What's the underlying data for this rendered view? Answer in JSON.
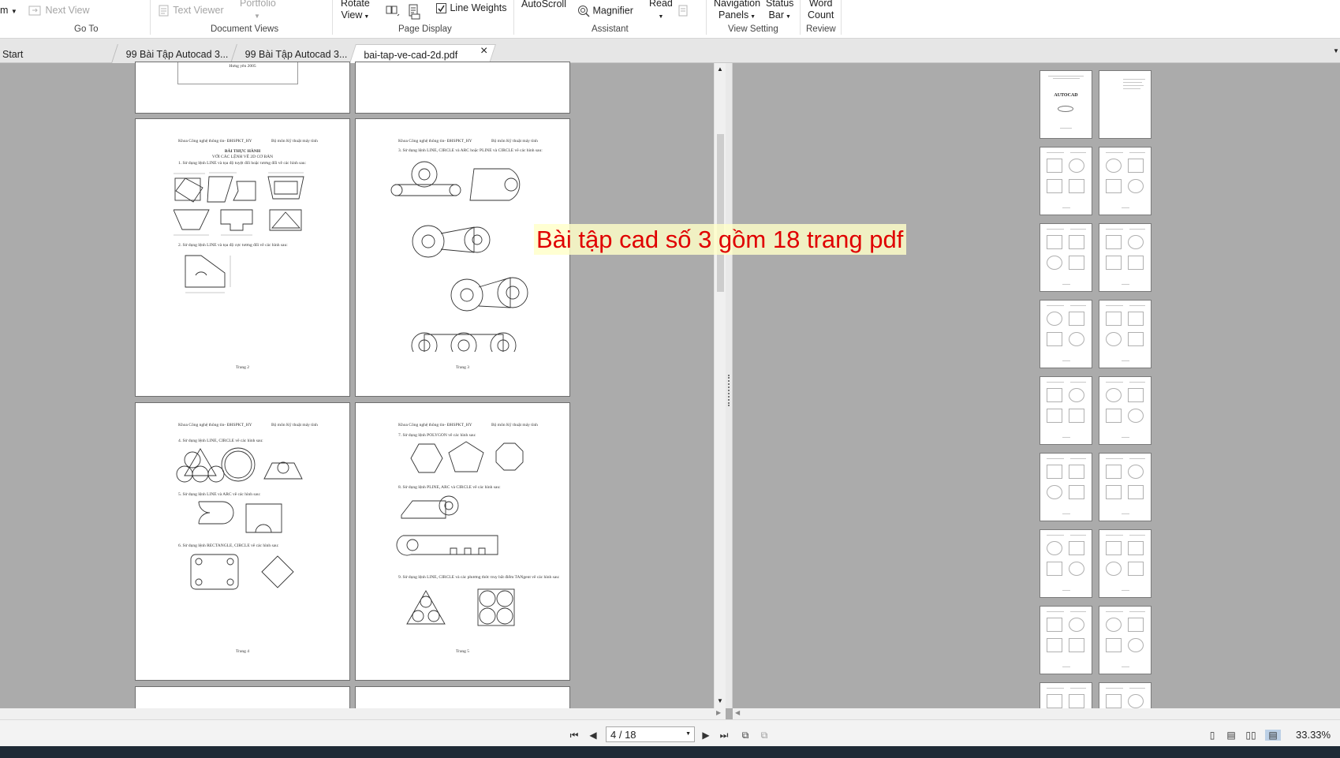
{
  "ribbon": {
    "goto": {
      "zoom_fragment": "m",
      "next_view": "Next View",
      "group_label": "Go To"
    },
    "document_views": {
      "text_viewer": "Text Viewer",
      "portfolio": "Portfolio",
      "group_label": "Document Views"
    },
    "page_display": {
      "rotate_view": [
        "Rotate",
        "View"
      ],
      "line_weights": "Line Weights",
      "line_weights_checked": true,
      "group_label": "Page Display"
    },
    "assistant": {
      "autoscroll": "AutoScroll",
      "magnifier": "Magnifier",
      "read": "Read",
      "group_label": "Assistant"
    },
    "view_setting": {
      "navigation_panels": [
        "Navigation",
        "Panels"
      ],
      "status_bar": [
        "Status",
        "Bar"
      ],
      "group_label": "View Setting"
    },
    "review": {
      "word_count": [
        "Word",
        "Count"
      ],
      "group_label": "Review"
    }
  },
  "tabs": [
    {
      "label": "Start"
    },
    {
      "label": "99 Bài Tập Autocad 3..."
    },
    {
      "label": "99 Bài Tập Autocad 3..."
    },
    {
      "label": "bai-tap-ve-cad-2d.pdf",
      "active": true,
      "close": "×"
    }
  ],
  "pages": {
    "p1_footer": "Hưng yên 2005",
    "header_left": "Khoa Công nghệ thông tin- ĐHSPKT_HY",
    "header_right": "Bộ môn Kỹ thuật máy tính",
    "p2": {
      "title": "BÀI THỰC HÀNH",
      "subtitle": "VỚI CÁC LỆNH VẼ 2D CƠ BẢN",
      "ex1": "1. Sử dụng lệnh LINE và tọa độ tuyệt đối hoặc tương đối vẽ các hình sau:",
      "ex2": "2. Sử dụng lệnh LINE  và tọa độ cực tương đối vẽ các hình sau:",
      "footer": "Trang 2"
    },
    "p3": {
      "ex3": "3. Sử dụng lệnh LINE, CIRCLE và ARC hoặc PLINE và CIRCLE vẽ các hình sau:",
      "footer": "Trang 3"
    },
    "p4": {
      "ex4": "4. Sử dụng lệnh LINE, CIRCLE vẽ các hình sau:",
      "ex5": "5. Sử dụng lệnh LINE và ARC vẽ các hình sau:",
      "ex6": "6. Sử dụng lệnh RECTANGLE, CIRCLE vẽ các hình sau:",
      "footer": "Trang 4"
    },
    "p5": {
      "ex7": "7. Sử dụng lệnh POLYGON vẽ các hình sau:",
      "ex8": "8. Sử dụng lệnh PLINE, ARC và CIRCLE vẽ các hình sau:",
      "ex9": "9. Sử dụng lệnh LINE, CIRCLE và các phương thức truy bắt điểm TANgent vẽ các hình sau:",
      "footer": "Trang 5"
    }
  },
  "thumbnail_cover": {
    "title": "AUTOCAD"
  },
  "overlay_caption": "Bài tập cad số 3 gồm 18 trang pdf",
  "statusbar": {
    "page_indicator": "4 / 18",
    "zoom": "33.33%"
  },
  "colors": {
    "caption_text": "#e00000",
    "caption_bg": "#ffffc8",
    "viewer_bg": "#ababab"
  }
}
